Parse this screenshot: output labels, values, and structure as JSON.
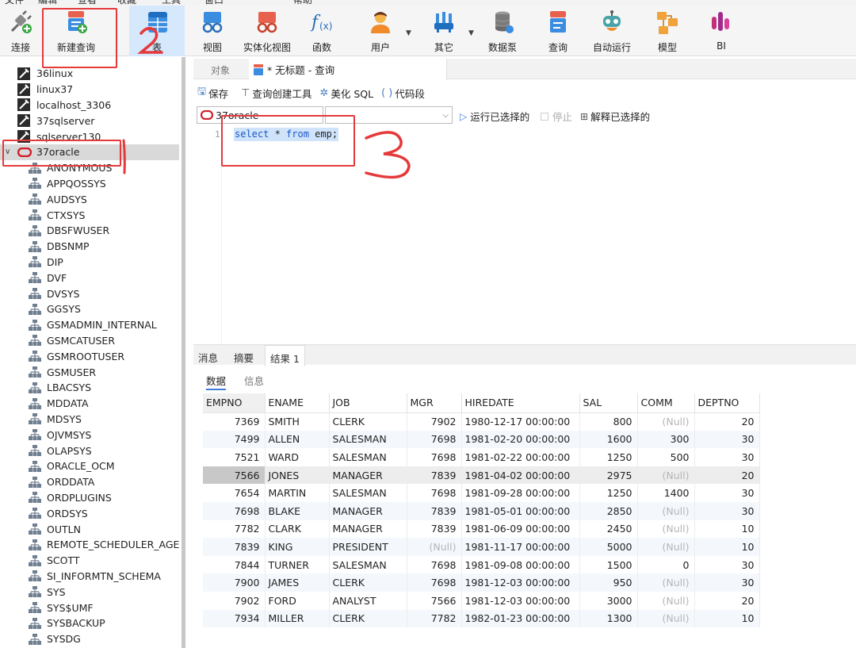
{
  "menu": [
    "文件",
    "编辑",
    "查看",
    "收藏",
    "工具",
    "窗口",
    "帮助"
  ],
  "toolbar": {
    "connect": "连接",
    "new_query": "新建查询",
    "table": "表",
    "view": "视图",
    "mview": "实体化视图",
    "function": "函数",
    "user": "用户",
    "other": "其它",
    "datapump": "数据泵",
    "query": "查询",
    "auto_run": "自动运行",
    "model": "模型",
    "bi": "BI"
  },
  "tree": {
    "connections_before": [
      "36linux",
      "linux37",
      "localhost_3306",
      "37sqlserver",
      "sqlserver130"
    ],
    "selected_connection": "37oracle",
    "schemas": [
      "ANONYMOUS",
      "APPQOSSYS",
      "AUDSYS",
      "CTXSYS",
      "DBSFWUSER",
      "DBSNMP",
      "DIP",
      "DVF",
      "DVSYS",
      "GGSYS",
      "GSMADMIN_INTERNAL",
      "GSMCATUSER",
      "GSMROOTUSER",
      "GSMUSER",
      "LBACSYS",
      "MDDATA",
      "MDSYS",
      "OJVMSYS",
      "OLAPSYS",
      "ORACLE_OCM",
      "ORDDATA",
      "ORDPLUGINS",
      "ORDSYS",
      "OUTLN",
      "REMOTE_SCHEDULER_AGENT",
      "SCOTT",
      "SI_INFORMTN_SCHEMA",
      "SYS",
      "SYS$UMF",
      "SYSBACKUP",
      "SYSDG"
    ]
  },
  "tabs": {
    "objects": "对象",
    "query_tab": "* 无标题 - 查询"
  },
  "query_toolbar": {
    "save": "保存",
    "builder": "查询创建工具",
    "beautify": "美化 SQL",
    "snippet": "代码段"
  },
  "conn_bar": {
    "connection": "37oracle",
    "run_selected": "运行已选择的",
    "stop": "停止",
    "explain_selected": "解释已选择的"
  },
  "editor": {
    "line": "1",
    "kw1": "select",
    "star": " * ",
    "kw2": "from",
    "rest": " emp;"
  },
  "result_tabs": {
    "messages": "消息",
    "summary": "摘要",
    "result1": "结果 1"
  },
  "sub_tabs": {
    "data": "数据",
    "info": "信息"
  },
  "grid": {
    "columns": [
      "EMPNO",
      "ENAME",
      "JOB",
      "MGR",
      "HIREDATE",
      "SAL",
      "COMM",
      "DEPTNO"
    ],
    "null_text": "(Null)",
    "rows": [
      [
        "7369",
        "SMITH",
        "CLERK",
        "7902",
        "1980-12-17 00:00:00",
        "800",
        null,
        "20"
      ],
      [
        "7499",
        "ALLEN",
        "SALESMAN",
        "7698",
        "1981-02-20 00:00:00",
        "1600",
        "300",
        "30"
      ],
      [
        "7521",
        "WARD",
        "SALESMAN",
        "7698",
        "1981-02-22 00:00:00",
        "1250",
        "500",
        "30"
      ],
      [
        "7566",
        "JONES",
        "MANAGER",
        "7839",
        "1981-04-02 00:00:00",
        "2975",
        null,
        "20"
      ],
      [
        "7654",
        "MARTIN",
        "SALESMAN",
        "7698",
        "1981-09-28 00:00:00",
        "1250",
        "1400",
        "30"
      ],
      [
        "7698",
        "BLAKE",
        "MANAGER",
        "7839",
        "1981-05-01 00:00:00",
        "2850",
        null,
        "30"
      ],
      [
        "7782",
        "CLARK",
        "MANAGER",
        "7839",
        "1981-06-09 00:00:00",
        "2450",
        null,
        "10"
      ],
      [
        "7839",
        "KING",
        "PRESIDENT",
        null,
        "1981-11-17 00:00:00",
        "5000",
        null,
        "10"
      ],
      [
        "7844",
        "TURNER",
        "SALESMAN",
        "7698",
        "1981-09-08 00:00:00",
        "1500",
        "0",
        "30"
      ],
      [
        "7900",
        "JAMES",
        "CLERK",
        "7698",
        "1981-12-03 00:00:00",
        "950",
        null,
        "30"
      ],
      [
        "7902",
        "FORD",
        "ANALYST",
        "7566",
        "1981-12-03 00:00:00",
        "3000",
        null,
        "20"
      ],
      [
        "7934",
        "MILLER",
        "CLERK",
        "7782",
        "1982-01-23 00:00:00",
        "1300",
        null,
        "10"
      ]
    ]
  },
  "annotations": {
    "step2": "2",
    "step3": "3",
    "step1": "1"
  },
  "colors": {
    "annotation_red": "#e5393b",
    "selection_blue": "#cfe4fb",
    "sql_keyword": "#1a55c7",
    "oracle_red": "#d0202c"
  }
}
